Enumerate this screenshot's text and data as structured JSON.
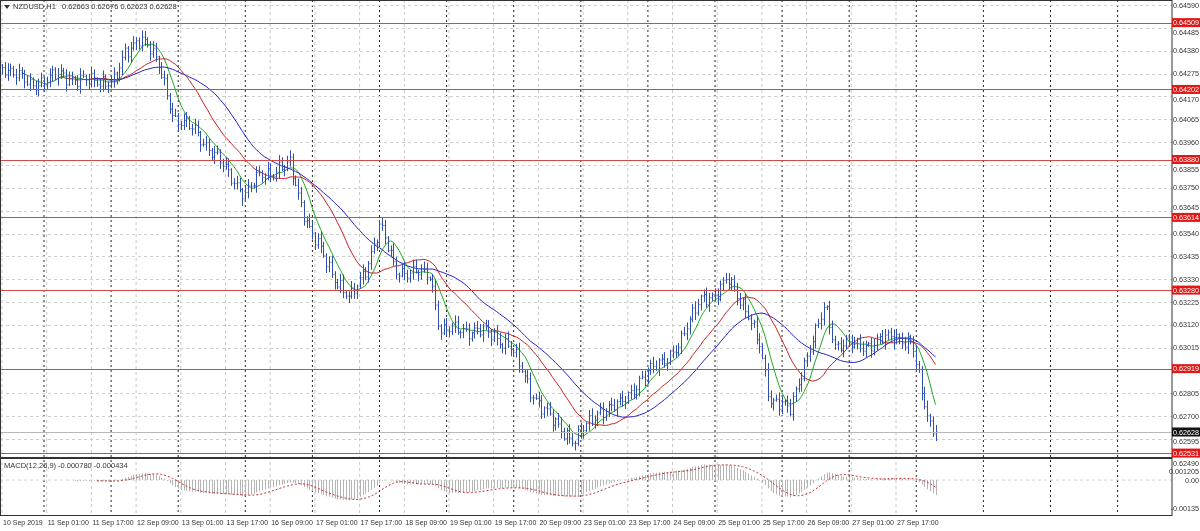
{
  "chart": {
    "symbol": "NZDUSD,H1",
    "ohlc": "0.62663 0.62676 0.62623 0.62628"
  },
  "price_axis": {
    "labels": [
      "0.64590",
      "0.64485",
      "0.64380",
      "0.64275",
      "0.64170",
      "0.64065",
      "0.63960",
      "0.63855",
      "0.63750",
      "0.63645",
      "0.63540",
      "0.63435",
      "0.63330",
      "0.63225",
      "0.63120",
      "0.63015",
      "0.62805",
      "0.62700",
      "0.62595",
      "0.62490"
    ]
  },
  "levels": [
    {
      "price": "0.64509"
    },
    {
      "price": "0.64202"
    },
    {
      "price": "0.63880"
    },
    {
      "price": "0.63614"
    },
    {
      "price": "0.63280"
    },
    {
      "price": "0.62919"
    },
    {
      "price": "0.62531"
    }
  ],
  "current_price": "0.62628",
  "time_axis": {
    "labels": [
      "10 Sep 2019",
      "11 Sep 01:00",
      "11 Sep 17:00",
      "12 Sep 09:00",
      "13 Sep 01:00",
      "13 Sep 17:00",
      "16 Sep 09:00",
      "17 Sep 01:00",
      "17 Sep 17:00",
      "18 Sep 09:00",
      "19 Sep 01:00",
      "19 Sep 17:00",
      "20 Sep 09:00",
      "23 Sep 01:00",
      "23 Sep 17:00",
      "24 Sep 09:00",
      "25 Sep 01:00",
      "25 Sep 17:00",
      "26 Sep 09:00",
      "27 Sep 01:00",
      "27 Sep 17:00"
    ]
  },
  "macd": {
    "title": "MACD(12,26,9)",
    "readout": "-0.000780 -0.000434",
    "axis_labels": [
      "0.001205",
      "0.00",
      "-0.00135"
    ]
  }
}
